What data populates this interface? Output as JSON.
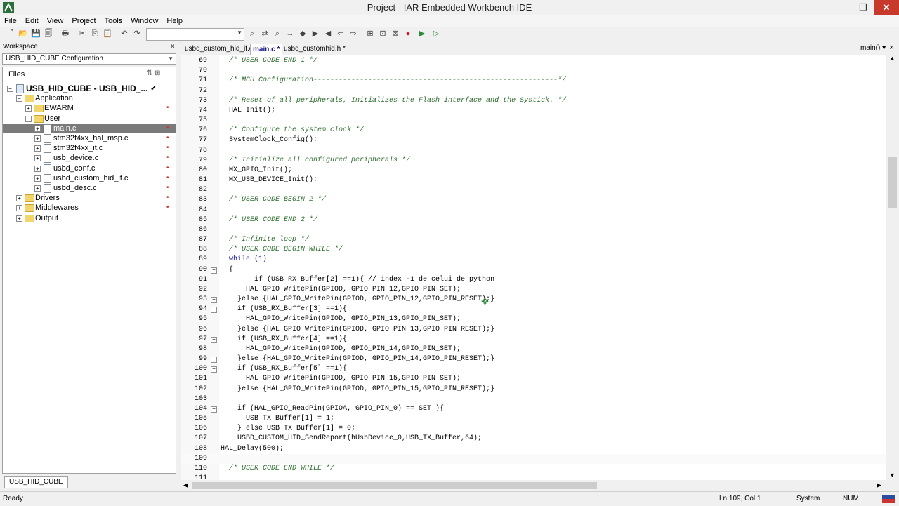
{
  "window": {
    "title": "Project - IAR Embedded Workbench IDE",
    "minimize": "—",
    "restore": "❐",
    "close": "✕"
  },
  "menu": [
    "File",
    "Edit",
    "View",
    "Project",
    "Tools",
    "Window",
    "Help"
  ],
  "toolbar": {
    "icons": [
      "new-file-icon",
      "open-icon",
      "save-icon",
      "save-all-icon",
      "print-icon",
      "cut-icon",
      "copy-icon",
      "paste-icon",
      "undo-icon",
      "redo-icon",
      "find-combo",
      "find-icon",
      "replace-icon",
      "find-in-files-icon",
      "goto-icon",
      "bookmark-icon",
      "next-bookmark-icon",
      "prev-bookmark-icon",
      "navigate-back-icon",
      "navigate-forward-icon",
      "compile-icon",
      "make-icon",
      "stop-build-icon",
      "breakpoint-icon",
      "download-debug-icon",
      "debug-icon"
    ],
    "glyphs": [
      "🗋",
      "📂",
      "💾",
      "🗐",
      "🖶",
      "✂",
      "⎘",
      "📋",
      "↶",
      "↷",
      "",
      "⌕",
      "⇄",
      "⌕",
      "→",
      "◆",
      "▶",
      "◀",
      "⇦",
      "⇨",
      "⊞",
      "⊡",
      "⊠",
      "●",
      "▶",
      "▷"
    ],
    "find_value": ""
  },
  "workspace": {
    "header": "Workspace",
    "close_glyph": "×",
    "configuration": "USB_HID_CUBE Configuration",
    "files_label": "Files",
    "files_icons": "⇅ ⊞",
    "bottom_tab": "USB_HID_CUBE",
    "tree": [
      {
        "label": "USB_HID_CUBE - USB_HID_...",
        "level": 0,
        "type": "project",
        "expander": "⊟",
        "bold": true,
        "check": "✔"
      },
      {
        "label": "Application",
        "level": 1,
        "type": "folder",
        "expander": "⊟"
      },
      {
        "label": "EWARM",
        "level": 2,
        "type": "folder",
        "expander": "⊞",
        "mark": "•"
      },
      {
        "label": "User",
        "level": 2,
        "type": "folder",
        "expander": "⊟"
      },
      {
        "label": "main.c",
        "level": 3,
        "type": "file",
        "expander": "⊞",
        "selected": true,
        "mark": "•"
      },
      {
        "label": "stm32f4xx_hal_msp.c",
        "level": 3,
        "type": "file",
        "expander": "⊞",
        "mark": "•"
      },
      {
        "label": "stm32f4xx_it.c",
        "level": 3,
        "type": "file",
        "expander": "⊞",
        "mark": "•"
      },
      {
        "label": "usb_device.c",
        "level": 3,
        "type": "file",
        "expander": "⊞",
        "mark": "•"
      },
      {
        "label": "usbd_conf.c",
        "level": 3,
        "type": "file",
        "expander": "⊞",
        "mark": "•"
      },
      {
        "label": "usbd_custom_hid_if.c",
        "level": 3,
        "type": "file",
        "expander": "⊞",
        "mark": "•"
      },
      {
        "label": "usbd_desc.c",
        "level": 3,
        "type": "file",
        "expander": "⊞",
        "mark": "•"
      },
      {
        "label": "Drivers",
        "level": 1,
        "type": "folder",
        "expander": "⊞",
        "mark": "•"
      },
      {
        "label": "Middlewares",
        "level": 1,
        "type": "folder",
        "expander": "⊞",
        "mark": "•"
      },
      {
        "label": "Output",
        "level": 1,
        "type": "folder",
        "expander": "⊞"
      }
    ]
  },
  "editor_tabs": {
    "tabs": [
      {
        "label": "usbd_custom_hid_if.c *",
        "active": false
      },
      {
        "label": "main.c *",
        "active": true
      },
      {
        "label": "usbd_customhid.h *",
        "active": false
      }
    ],
    "function_selector": "main()",
    "function_arrow": "▾",
    "close_glyph": "×"
  },
  "code_lines": [
    {
      "n": "69",
      "text": "  /* USER CODE END 1 */",
      "kind": "comment"
    },
    {
      "n": "70",
      "text": "",
      "kind": "code"
    },
    {
      "n": "71",
      "text": "  /* MCU Configuration----------------------------------------------------------*/",
      "kind": "comment"
    },
    {
      "n": "72",
      "text": "",
      "kind": "code"
    },
    {
      "n": "73",
      "text": "  /* Reset of all peripherals, Initializes the Flash interface and the Systick. */",
      "kind": "comment"
    },
    {
      "n": "74",
      "text": "  HAL_Init();",
      "kind": "code"
    },
    {
      "n": "75",
      "text": "",
      "kind": "code"
    },
    {
      "n": "76",
      "text": "  /* Configure the system clock */",
      "kind": "comment"
    },
    {
      "n": "77",
      "text": "  SystemClock_Config();",
      "kind": "code"
    },
    {
      "n": "78",
      "text": "",
      "kind": "code"
    },
    {
      "n": "79",
      "text": "  /* Initialize all configured peripherals */",
      "kind": "comment"
    },
    {
      "n": "80",
      "text": "  MX_GPIO_Init();",
      "kind": "code"
    },
    {
      "n": "81",
      "text": "  MX_USB_DEVICE_Init();",
      "kind": "code"
    },
    {
      "n": "82",
      "text": "",
      "kind": "code"
    },
    {
      "n": "83",
      "text": "  /* USER CODE BEGIN 2 */",
      "kind": "comment"
    },
    {
      "n": "84",
      "text": "",
      "kind": "code"
    },
    {
      "n": "85",
      "text": "  /* USER CODE END 2 */",
      "kind": "comment"
    },
    {
      "n": "86",
      "text": "",
      "kind": "code"
    },
    {
      "n": "87",
      "text": "  /* Infinite loop */",
      "kind": "comment"
    },
    {
      "n": "88",
      "text": "  /* USER CODE BEGIN WHILE */",
      "kind": "comment"
    },
    {
      "n": "89",
      "text": "  while (1)",
      "kind": "keyword"
    },
    {
      "n": "90",
      "text": "  {",
      "kind": "code",
      "fold": "⊟"
    },
    {
      "n": "91",
      "text": "        if (USB_RX_Buffer[2] ==1){ // index -1 de celui de python",
      "kind": "code"
    },
    {
      "n": "92",
      "text": "      HAL_GPIO_WritePin(GPIOD, GPIO_PIN_12,GPIO_PIN_SET);",
      "kind": "code"
    },
    {
      "n": "93",
      "text": "    }else {HAL_GPIO_WritePin(GPIOD, GPIO_PIN_12,GPIO_PIN_RESET);}",
      "kind": "code",
      "fold": "⊟"
    },
    {
      "n": "94",
      "text": "    if (USB_RX_Buffer[3] ==1){",
      "kind": "code",
      "fold": "⊟"
    },
    {
      "n": "95",
      "text": "      HAL_GPIO_WritePin(GPIOD, GPIO_PIN_13,GPIO_PIN_SET);",
      "kind": "code"
    },
    {
      "n": "96",
      "text": "    }else {HAL_GPIO_WritePin(GPIOD, GPIO_PIN_13,GPIO_PIN_RESET);}",
      "kind": "code"
    },
    {
      "n": "97",
      "text": "    if (USB_RX_Buffer[4] ==1){",
      "kind": "code",
      "fold": "⊟"
    },
    {
      "n": "98",
      "text": "      HAL_GPIO_WritePin(GPIOD, GPIO_PIN_14,GPIO_PIN_SET);",
      "kind": "code"
    },
    {
      "n": "99",
      "text": "    }else {HAL_GPIO_WritePin(GPIOD, GPIO_PIN_14,GPIO_PIN_RESET);}",
      "kind": "code",
      "fold": "⊟"
    },
    {
      "n": "100",
      "text": "    if (USB_RX_Buffer[5] ==1){",
      "kind": "code",
      "fold": "⊟"
    },
    {
      "n": "101",
      "text": "      HAL_GPIO_WritePin(GPIOD, GPIO_PIN_15,GPIO_PIN_SET);",
      "kind": "code"
    },
    {
      "n": "102",
      "text": "    }else {HAL_GPIO_WritePin(GPIOD, GPIO_PIN_15,GPIO_PIN_RESET);}",
      "kind": "code"
    },
    {
      "n": "103",
      "text": "",
      "kind": "code"
    },
    {
      "n": "104",
      "text": "    if (HAL_GPIO_ReadPin(GPIOA, GPIO_PIN_0) == SET ){",
      "kind": "code",
      "fold": "⊟"
    },
    {
      "n": "105",
      "text": "      USB_TX_Buffer[1] = 1;",
      "kind": "code"
    },
    {
      "n": "106",
      "text": "    } else USB_TX_Buffer[1] = 0;",
      "kind": "code"
    },
    {
      "n": "107",
      "text": "    USBD_CUSTOM_HID_SendReport(hUsbDevice_0,USB_TX_Buffer,64);",
      "kind": "code"
    },
    {
      "n": "108",
      "text": "HAL_Delay(500);",
      "kind": "code"
    },
    {
      "n": "109",
      "text": "",
      "kind": "code"
    },
    {
      "n": "110",
      "text": "  /* USER CODE END WHILE */",
      "kind": "comment"
    },
    {
      "n": "111",
      "text": "",
      "kind": "code"
    }
  ],
  "status": {
    "ready": "Ready",
    "position": "Ln 109, Col 1",
    "mode": "System",
    "num": "NUM"
  },
  "colors": {
    "comment": "#2e6e2e",
    "keyword": "#1c1c9c",
    "selection": "#7a7a7a",
    "close_button": "#c7392b"
  }
}
